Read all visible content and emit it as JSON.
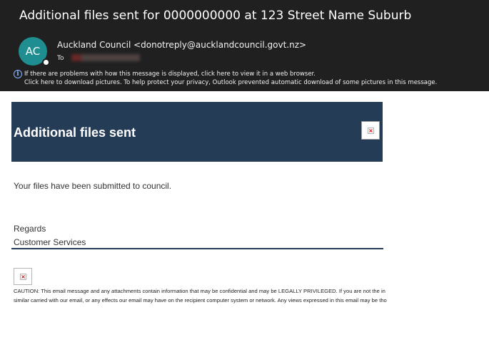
{
  "header": {
    "subject": "Additional files sent for 0000000000 at 123 Street Name Suburb",
    "avatar_initials": "AC",
    "sender": "Auckland Council <donotreply@aucklandcouncil.govt.nz>",
    "to_label": "To",
    "info_line_1": "If there are problems with how this message is displayed, click here to view it in a web browser.",
    "info_line_2": "Click here to download pictures. To help protect your privacy, Outlook prevented automatic download of some pictures in this message."
  },
  "email": {
    "banner_title": "Additional files sent",
    "body_line": "Your files have been submitted to council.",
    "regards": "Regards",
    "signature": "Customer Services",
    "caution_line_1": "CAUTION: This email message and any attachments contain information that may be confidential and may be LEGALLY PRIVILEGED. If you are not the in",
    "caution_line_2": "similar carried with our email, or any effects our email may have on the recipient computer system or network. Any views expressed in this email may be tho"
  },
  "colors": {
    "header_bg": "#202020",
    "avatar_bg": "#1e8e91",
    "banner_bg": "#243c56",
    "info_icon": "#8ab4ff"
  },
  "icons": {
    "info": "info-icon",
    "broken_image": "broken-image-icon"
  }
}
